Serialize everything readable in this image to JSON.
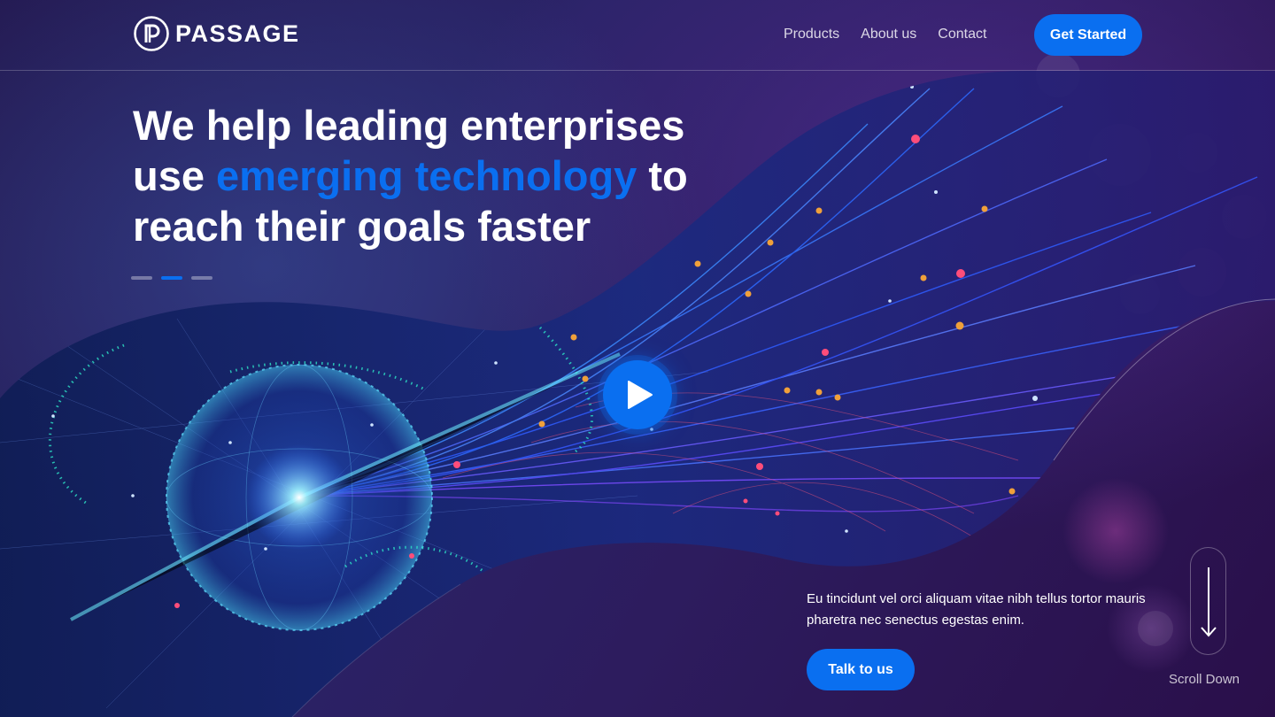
{
  "brand": {
    "name": "PASSAGE"
  },
  "nav": {
    "products": "Products",
    "about": "About us",
    "contact": "Contact"
  },
  "header": {
    "cta": "Get Started"
  },
  "hero": {
    "line1": "We help leading enterprises",
    "line2_pre": "use ",
    "line2_accent": "emerging technology",
    "line2_post": " to",
    "line3": "reach their goals faster",
    "slides_total": 3,
    "slide_active": 2
  },
  "video": {
    "icon": "play-icon"
  },
  "intro": {
    "text": "Eu tincidunt vel orci aliquam vitae nibh tellus tortor mauris pharetra nec senectus egestas enim.",
    "cta": "Talk to us"
  },
  "scroll": {
    "label": "Scroll Down",
    "icon": "arrow-down-icon"
  },
  "colors": {
    "accent": "#0a6ff0",
    "background": "#2a2367"
  }
}
